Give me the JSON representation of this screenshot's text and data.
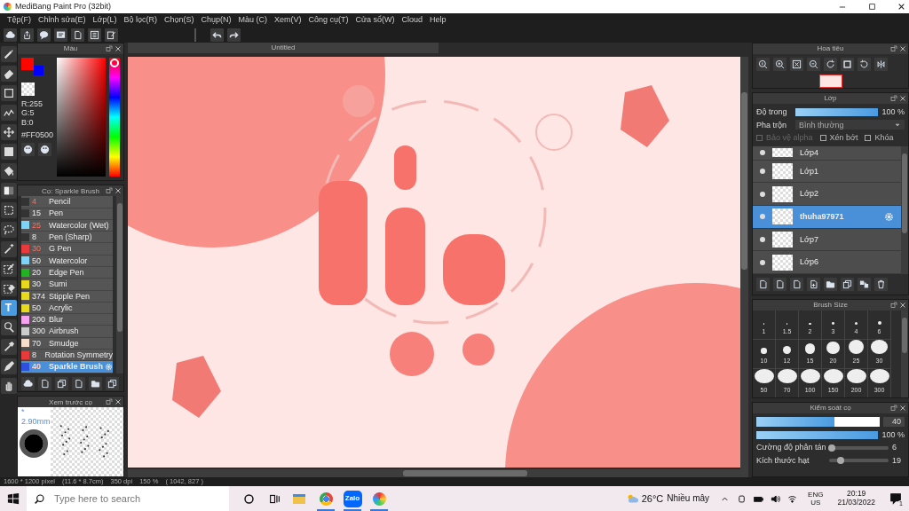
{
  "window": {
    "title": "MediBang Paint Pro (32bit)"
  },
  "menu": [
    "Tệp(F)",
    "Chỉnh sửa(E)",
    "Lớp(L)",
    "Bộ lọc(R)",
    "Chọn(S)",
    "Chụp(N)",
    "Màu (C)",
    "Xem(V)",
    "Công cụ(T)",
    "Cửa sổ(W)",
    "Cloud",
    "Help"
  ],
  "tools": [
    {
      "kind": "brush",
      "selected": false
    },
    {
      "kind": "eraser",
      "selected": false
    },
    {
      "kind": "square",
      "selected": false
    },
    {
      "kind": "check",
      "selected": false
    },
    {
      "kind": "move",
      "selected": false
    },
    {
      "kind": "fsq",
      "selected": false
    },
    {
      "kind": "bucket",
      "selected": false
    },
    {
      "kind": "gradient",
      "selected": false
    },
    {
      "kind": "dsel",
      "selected": false
    },
    {
      "kind": "lasso",
      "selected": false
    },
    {
      "kind": "wand",
      "selected": false
    },
    {
      "kind": "pensq",
      "selected": false
    },
    {
      "kind": "erasq",
      "selected": false
    },
    {
      "kind": "text",
      "glyph": "T",
      "selected": true
    },
    {
      "kind": "pointer",
      "selected": false
    },
    {
      "kind": "dropper",
      "selected": false
    },
    {
      "kind": "pen",
      "selected": false
    },
    {
      "kind": "hand",
      "selected": false
    }
  ],
  "color_panel": {
    "title": "Màu",
    "swatches": [
      {
        "kind": "foreground",
        "color": "#ff0500"
      },
      {
        "kind": "background",
        "color": "#0000ff"
      }
    ],
    "hue_slider": {
      "level": 0.02
    },
    "rgb": [
      "R:255",
      "G:5",
      "B:0"
    ],
    "hex": "#FF0500"
  },
  "brush_panel": {
    "title": "Cọ: Sparkle Brush",
    "brushes": [
      {
        "size": "4",
        "name": "Pencil",
        "color": "#333333",
        "size_flagged": true,
        "selected": false
      },
      {
        "size": "15",
        "name": "Pen",
        "color": "#333333",
        "size_flagged": false,
        "selected": false
      },
      {
        "size": "25",
        "name": "Watercolor (Wet)",
        "color": "#7fd3f5",
        "size_flagged": true,
        "selected": false
      },
      {
        "size": "8",
        "name": "Pen (Sharp)",
        "color": "#333333",
        "size_flagged": false,
        "selected": false
      },
      {
        "size": "30",
        "name": "G Pen",
        "color": "#e83a3a",
        "size_flagged": true,
        "selected": false
      },
      {
        "size": "50",
        "name": "Watercolor",
        "color": "#7fd3f5",
        "size_flagged": false,
        "selected": false
      },
      {
        "size": "20",
        "name": "Edge Pen",
        "color": "#22b322",
        "size_flagged": false,
        "selected": false
      },
      {
        "size": "30",
        "name": "Sumi",
        "color": "#e8d81e",
        "size_flagged": false,
        "selected": false
      },
      {
        "size": "374",
        "name": "Stipple Pen",
        "color": "#e8d81e",
        "size_flagged": false,
        "selected": false
      },
      {
        "size": "50",
        "name": "Acrylic",
        "color": "#e8d81e",
        "size_flagged": false,
        "selected": false
      },
      {
        "size": "200",
        "name": "Blur",
        "color": "#f5a3f0",
        "size_flagged": false,
        "selected": false
      },
      {
        "size": "300",
        "name": "Airbrush",
        "color": "#cccccc",
        "size_flagged": false,
        "selected": false
      },
      {
        "size": "70",
        "name": "Smudge",
        "color": "#f6dccb",
        "size_flagged": false,
        "selected": false
      },
      {
        "size": "8",
        "name": "Rotation Symmetry",
        "color": "#e83a3a",
        "size_flagged": false,
        "selected": false
      },
      {
        "size": "40",
        "name": "Sparkle Brush",
        "color": "#2f4fe0",
        "size_flagged": true,
        "selected": true
      }
    ]
  },
  "preview": {
    "title": "Xem trước cọ",
    "size": "* 2.90mm"
  },
  "canvas": {
    "tab": "Untitled"
  },
  "navigator": {
    "title": "Hoa tiêu"
  },
  "layers_panel": {
    "title": "Lớp",
    "opacity_label": "Độ trong",
    "opacity": {
      "level": 1,
      "reading": "100 %"
    },
    "blend_label": "Pha trộn",
    "blend": "Bình thường",
    "options": [
      {
        "label": "Bảo vệ alpha",
        "checked": false,
        "disabled": true
      },
      {
        "label": "Xén bớt",
        "checked": false,
        "disabled": false
      },
      {
        "label": "Khóa",
        "checked": false,
        "disabled": false
      }
    ],
    "layers": [
      {
        "name": "Lớp4",
        "selected": false
      },
      {
        "name": "Lớp1",
        "selected": false
      },
      {
        "name": "Lớp2",
        "selected": false
      },
      {
        "name": "thuha97971",
        "selected": true
      },
      {
        "name": "Lớp7",
        "selected": false
      },
      {
        "name": "Lớp6",
        "selected": false
      }
    ]
  },
  "brush_size": {
    "title": "Brush Size",
    "sizes": [
      "1",
      "1.5",
      "2",
      "3",
      "4",
      "6",
      "10",
      "12",
      "15",
      "20",
      "25",
      "30",
      "50",
      "70",
      "100",
      "150",
      "200",
      "300"
    ]
  },
  "brush_control": {
    "title": "Kiểm soát cọ",
    "size": {
      "level": 0.63,
      "value": "40"
    },
    "opacity": {
      "level": 1,
      "reading": "100 %"
    },
    "sliders": [
      {
        "label": "Cường độ phân tán",
        "level": 0.05,
        "value": "6"
      },
      {
        "label": "Kích thước hạt",
        "level": 0.2,
        "value": "19"
      }
    ]
  },
  "status_bar": [
    "1600 * 1200 pixel",
    "(11.6 * 8.7cm)",
    "350 dpi",
    "150 %",
    "( 1042, 827 )"
  ],
  "taskbar": {
    "search": {
      "placeholder": "Type here to search"
    },
    "apps": [
      {
        "kind": "explorer",
        "running": false
      },
      {
        "kind": "chrome",
        "running": true
      },
      {
        "kind": "zalo",
        "label": "Zalo",
        "running": true
      },
      {
        "kind": "medibang",
        "running": true
      }
    ],
    "temperature": "26°C",
    "weather": "Nhiều mây",
    "lang": "ENG",
    "region": "US",
    "time": "20:19",
    "date": "21/03/2022",
    "notifications": "1"
  }
}
